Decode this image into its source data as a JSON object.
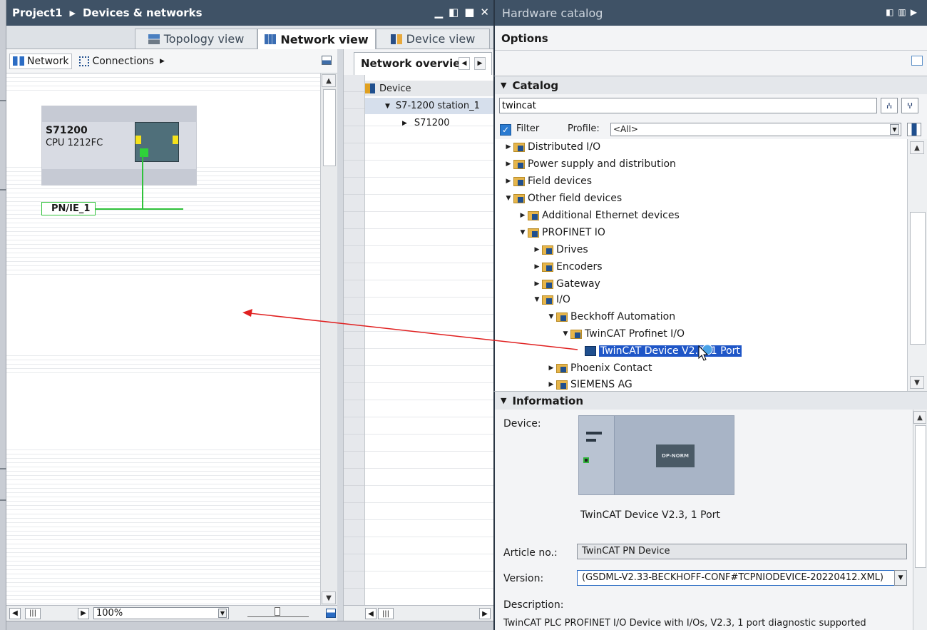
{
  "editor": {
    "breadcrumb": [
      "Project1",
      "Devices & networks"
    ],
    "tabs": [
      {
        "label": "Topology view"
      },
      {
        "label": "Network view"
      },
      {
        "label": "Device view"
      }
    ],
    "toolbar": {
      "network_label": "Network",
      "connections_label": "Connections"
    },
    "device": {
      "name": "S71200",
      "cpu": "CPU 1212FC"
    },
    "subnet_label": "PN/IE_1",
    "zoom": "100%"
  },
  "network_overview": {
    "tab_label": "Network overview",
    "column_device": "Device",
    "rows": [
      "S7-1200 station_1",
      "S71200"
    ]
  },
  "catalog": {
    "title": "Hardware catalog",
    "options_label": "Options",
    "catalog_label": "Catalog",
    "search_value": "twincat",
    "filter_label": "Filter",
    "profile_label": "Profile:",
    "profile_value": "<All>",
    "tree": [
      {
        "label": "Distributed I/O",
        "level": 0,
        "state": "collapsed",
        "kind": "folder"
      },
      {
        "label": "Power supply and distribution",
        "level": 0,
        "state": "collapsed",
        "kind": "folder"
      },
      {
        "label": "Field devices",
        "level": 0,
        "state": "collapsed",
        "kind": "folder"
      },
      {
        "label": "Other field devices",
        "level": 0,
        "state": "expanded",
        "kind": "folder"
      },
      {
        "label": "Additional Ethernet devices",
        "level": 1,
        "state": "collapsed",
        "kind": "folder"
      },
      {
        "label": "PROFINET IO",
        "level": 1,
        "state": "expanded",
        "kind": "folder"
      },
      {
        "label": "Drives",
        "level": 2,
        "state": "collapsed",
        "kind": "folder"
      },
      {
        "label": "Encoders",
        "level": 2,
        "state": "collapsed",
        "kind": "folder"
      },
      {
        "label": "Gateway",
        "level": 2,
        "state": "collapsed",
        "kind": "folder"
      },
      {
        "label": "I/O",
        "level": 2,
        "state": "expanded",
        "kind": "folder"
      },
      {
        "label": "Beckhoff Automation",
        "level": 3,
        "state": "expanded",
        "kind": "folder"
      },
      {
        "label": "TwinCAT Profinet I/O",
        "level": 4,
        "state": "expanded",
        "kind": "folder"
      },
      {
        "label": "TwinCAT Device V2.3, 1 Port",
        "level": 5,
        "state": "leaf",
        "kind": "device",
        "selected": true
      },
      {
        "label": "Phoenix Contact",
        "level": 3,
        "state": "collapsed",
        "kind": "folder"
      },
      {
        "label": "SIEMENS AG",
        "level": 3,
        "state": "collapsed",
        "kind": "folder"
      }
    ]
  },
  "information": {
    "title": "Information",
    "device_label": "Device:",
    "device_name": "TwinCAT Device V2.3, 1 Port",
    "device_image_text": "DP-NORM",
    "article_label": "Article no.:",
    "article_value": "TwinCAT PN Device",
    "version_label": "Version:",
    "version_value": "(GSDML-V2.33-BECKHOFF-CONF#TCPNIODEVICE-20220412.XML)",
    "description_label": "Description:",
    "description_value": "TwinCAT PLC PROFINET I/O Device with I/Os, V2.3, 1 port diagnostic supported"
  },
  "colors": {
    "title_bar": "#3f5266",
    "selection": "#1f56c7",
    "link_green": "#2fc23a",
    "drag_arrow": "#e02020"
  }
}
